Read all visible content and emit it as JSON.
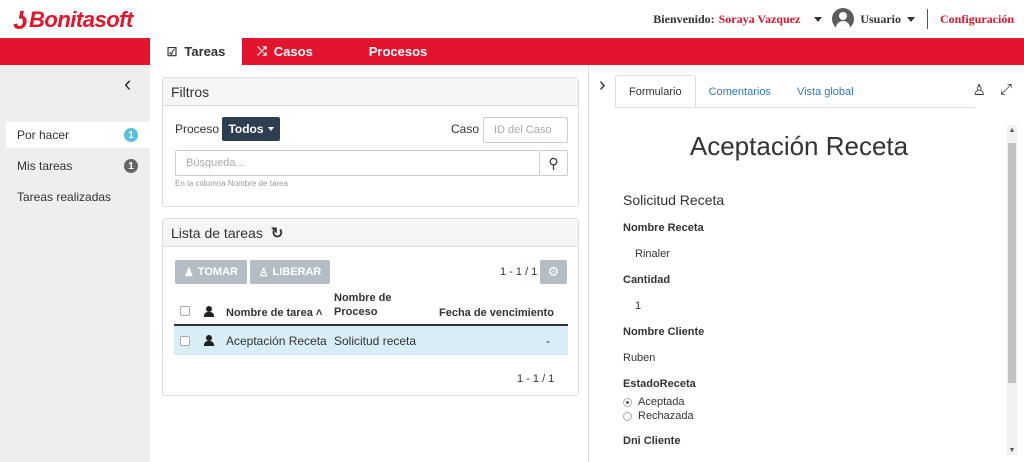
{
  "header": {
    "brand": "Bonitasoft",
    "welcome": "Bienvenido:",
    "username": "Soraya Vazquez",
    "profile": "Usuario",
    "config": "Configuración"
  },
  "nav": {
    "tabs": [
      {
        "label": "Tareas",
        "icon": "checkbox-icon"
      },
      {
        "label": "Casos",
        "icon": "shuffle-icon"
      },
      {
        "label": "Procesos"
      }
    ]
  },
  "sidebar": {
    "items": [
      {
        "label": "Por hacer",
        "count": "1"
      },
      {
        "label": "Mis tareas",
        "count": "1"
      },
      {
        "label": "Tareas realizadas"
      }
    ]
  },
  "filters": {
    "title": "Filtros",
    "process_label": "Proceso",
    "process_value": "Todos",
    "case_label": "Caso",
    "case_placeholder": "ID del Caso",
    "search_placeholder": "Búsqueda...",
    "search_help": "En la columna Nombre de tarea"
  },
  "tasks": {
    "title": "Lista de tareas",
    "take_label": "TOMAR",
    "release_label": "LIBERAR",
    "pager_top": "1 - 1 / 1",
    "pager_bottom": "1 - 1 / 1",
    "columns": [
      "Nombre de tarea",
      "Nombre de Proceso",
      "Fecha de vencimiento"
    ],
    "rows": [
      {
        "name": "Aceptación Receta",
        "process": "Solicitud receta",
        "due": "-"
      }
    ]
  },
  "detail": {
    "tabs": [
      "Formulario",
      "Comentarios",
      "Vista global"
    ],
    "form_title": "Aceptación Receta",
    "section": "Solicitud Receta",
    "fields": [
      {
        "label": "Nombre Receta",
        "value": "Rinaler"
      },
      {
        "label": "Cantidad",
        "value": "1"
      },
      {
        "label": "Nombre Cliente",
        "value": "Ruben"
      },
      {
        "label": "EstadoReceta"
      },
      {
        "label": "Dni Cliente"
      }
    ],
    "radio_options": [
      "Aceptada",
      "Rechazada"
    ],
    "radio_selected": "Aceptada"
  },
  "colors": {
    "brand_red": "#e2152c",
    "dark_button": "#2c3e50",
    "selected_row": "#d9edf7",
    "badge_blue": "#5bc0de"
  }
}
